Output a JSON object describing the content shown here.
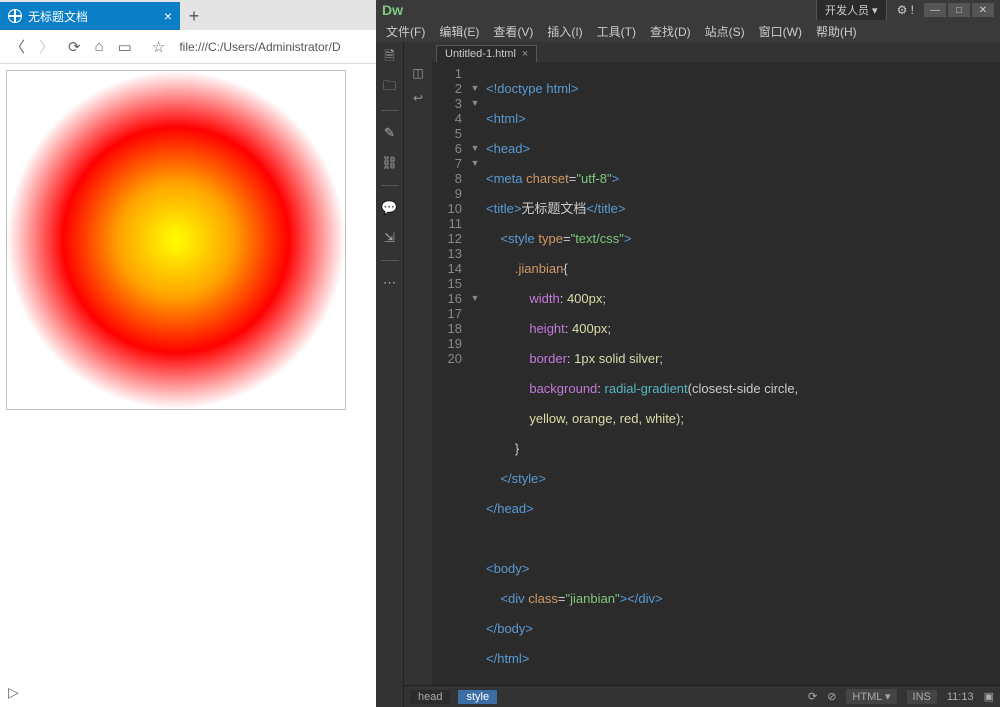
{
  "browser": {
    "tab_title": "无标题文档",
    "url_prefix": "file:///C:/Users/Administrator/D",
    "star": "☆"
  },
  "dw": {
    "logo": "Dw",
    "workspace_label": "开发人员 ▾",
    "gear": "⚙ !",
    "menus": [
      "文件(F)",
      "编辑(E)",
      "查看(V)",
      "插入(I)",
      "工具(T)",
      "查找(D)",
      "站点(S)",
      "窗口(W)",
      "帮助(H)"
    ],
    "file_tab": "Untitled-1.html",
    "line_numbers": [
      "1",
      "2",
      "3",
      "4",
      "5",
      "6",
      "7",
      "8",
      "9",
      "10",
      "11",
      "12",
      "13",
      "14",
      "15",
      "16",
      "17",
      "18",
      "19",
      "20"
    ],
    "folds": [
      "",
      "▼",
      "▼",
      "",
      "",
      "▼",
      "▼",
      "",
      "",
      "",
      "",
      "",
      "",
      "",
      "",
      "▼",
      "",
      "",
      "",
      ""
    ],
    "breadcrumb_head": "head",
    "breadcrumb_style": "style",
    "lang": "HTML",
    "ins": "INS",
    "pos": "11:13",
    "code": {
      "l1": [
        "<!doctype html>"
      ],
      "l2_open": "<",
      "l2_tag": "html",
      "l2_close": ">",
      "l3_open": "<",
      "l3_tag": "head",
      "l3_close": ">",
      "l4_open": "<",
      "l4_tag": "meta",
      "l4_sp": " ",
      "l4_attr": "charset",
      "l4_eq": "=",
      "l4_val": "\"utf-8\"",
      "l4_end": ">",
      "l5_open": "<",
      "l5_tag": "title",
      "l5_close": ">",
      "l5_text": "无标题文档",
      "l5_open2": "</",
      "l5_tag2": "title",
      "l5_close2": ">",
      "l6_open": "<",
      "l6_tag": "style",
      "l6_sp": " ",
      "l6_attr": "type",
      "l6_eq": "=",
      "l6_val": "\"text/css\"",
      "l6_end": ">",
      "l7": ".jianbian",
      "l7b": "{",
      "l8p": "width",
      "l8c": ": ",
      "l8v": "400px",
      "l8s": ";",
      "l9p": "height",
      "l9c": ": ",
      "l9v": "400px",
      "l9s": ";",
      "l10p": "border",
      "l10c": ": ",
      "l10v": "1px solid silver",
      "l10s": ";",
      "l11p": "background",
      "l11c": ": ",
      "l11f": "radial-gradient",
      "l11a": "(closest-side circle,",
      "l11b": "yellow, orange, red, white);",
      "l12": "}",
      "l13": "</",
      "l13t": "style",
      "l13c": ">",
      "l14": "</",
      "l14t": "head",
      "l14c": ">",
      "l16": "<",
      "l16t": "body",
      "l16c": ">",
      "l17": "<",
      "l17t": "div",
      "l17sp": " ",
      "l17a": "class",
      "l17eq": "=",
      "l17v": "\"jianbian\"",
      "l17m": "></",
      "l17t2": "div",
      "l17c": ">",
      "l18": "</",
      "l18t": "body",
      "l18c": ">",
      "l19": "</",
      "l19t": "html",
      "l19c": ">"
    }
  }
}
